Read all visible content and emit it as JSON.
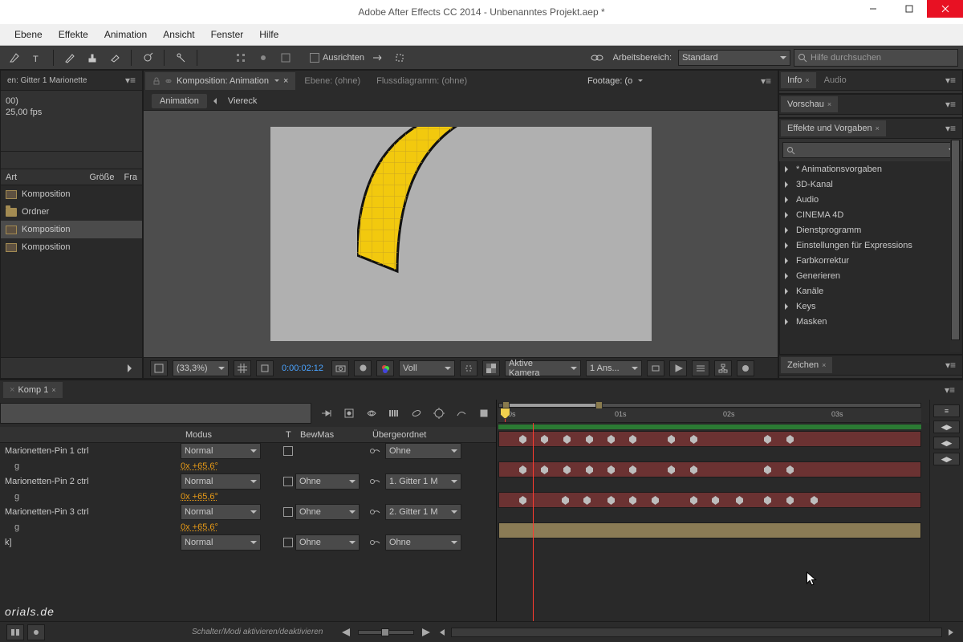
{
  "title": "Adobe After Effects CC 2014 - Unbenanntes Projekt.aep *",
  "menubar": [
    "Ebene",
    "Effekte",
    "Animation",
    "Ansicht",
    "Fenster",
    "Hilfe"
  ],
  "toolbar": {
    "align": "Ausrichten",
    "wsLabel": "Arbeitsbereich:",
    "workspace": "Standard",
    "search_placeholder": "Hilfe durchsuchen"
  },
  "project": {
    "info1": "00)",
    "info2": "25,00 fps",
    "cols": {
      "name": "Art",
      "size": "Größe",
      "fr": "Fra"
    },
    "rows": [
      {
        "label": "Komposition",
        "type": "comp"
      },
      {
        "label": "Ordner",
        "type": "folder"
      },
      {
        "label": "Komposition",
        "type": "comp",
        "sel": true
      },
      {
        "label": "Komposition",
        "type": "comp"
      }
    ]
  },
  "comp": {
    "tab1": "Komposition: Animation",
    "tab2": "Ebene: (ohne)",
    "tab3": "Flussdiagramm: (ohne)",
    "tab4": "Footage: (o",
    "bc1": "Animation",
    "bc2": "Viereck",
    "zoom": "(33,3%)",
    "time": "0:00:02:12",
    "res": "Voll",
    "camera": "Aktive Kamera",
    "views": "1 Ans..."
  },
  "right": {
    "info": "Info",
    "audio": "Audio",
    "vorschau": "Vorschau",
    "fx": "Effekte und Vorgaben",
    "search_placeholder": "",
    "zeichen": "Zeichen",
    "fxlist": [
      "* Animationsvorgaben",
      "3D-Kanal",
      "Audio",
      "CINEMA 4D",
      "Dienstprogramm",
      "Einstellungen für Expressions",
      "Farbkorrektur",
      "Generieren",
      "Kanäle",
      "Keys",
      "Masken"
    ]
  },
  "timeline": {
    "tab": "Komp 1",
    "cols": {
      "mode": "Modus",
      "t": "T",
      "bm": "BewMas",
      "par": "Übergeordnet"
    },
    "layers": [
      {
        "name": "Marionetten-Pin 1 ctrl",
        "mode": "Normal",
        "bm": "",
        "par": "Ohne",
        "rot": "0x +65,6°",
        "sublabel": "g"
      },
      {
        "name": "Marionetten-Pin 2 ctrl",
        "mode": "Normal",
        "bm": "Ohne",
        "par": "1. Gitter 1 M",
        "rot": "0x +65,6°",
        "sublabel": "g"
      },
      {
        "name": "Marionetten-Pin 3 ctrl",
        "mode": "Normal",
        "bm": "Ohne",
        "par": "2. Gitter 1 M",
        "rot": "0x +65,6°",
        "sublabel": "g"
      },
      {
        "name": "k]",
        "mode": "Normal",
        "bm": "Ohne",
        "par": "Ohne"
      }
    ],
    "ticks": [
      "0s",
      "01s",
      "02s",
      "03s"
    ],
    "footerMsg": "Schalter/Modi aktivieren/deaktivieren"
  },
  "branding": "orials.de"
}
